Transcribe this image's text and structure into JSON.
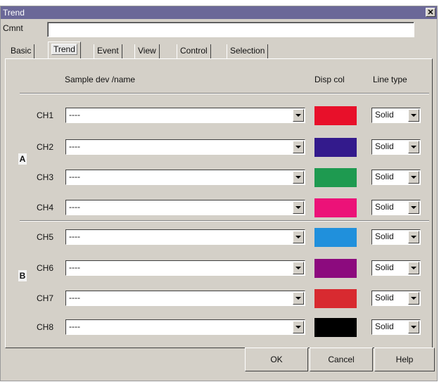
{
  "window": {
    "title": "Trend"
  },
  "comment": {
    "label": "Cmnt",
    "value": ""
  },
  "tabs": [
    "Basic",
    "Trend",
    "Event",
    "View",
    "Control",
    "Selection"
  ],
  "active_tab": "Trend",
  "headers": {
    "sample": "Sample dev /name",
    "color": "Disp col",
    "line_type": "Line type"
  },
  "groups": [
    "A",
    "B"
  ],
  "channels": [
    {
      "label": "CH1",
      "device": "----",
      "color": "#e8102a",
      "line_type": "Solid"
    },
    {
      "label": "CH2",
      "device": "----",
      "color": "#331a8c",
      "line_type": "Solid"
    },
    {
      "label": "CH3",
      "device": "----",
      "color": "#1e9a50",
      "line_type": "Solid"
    },
    {
      "label": "CH4",
      "device": "----",
      "color": "#ec1278",
      "line_type": "Solid"
    },
    {
      "label": "CH5",
      "device": "----",
      "color": "#2090dc",
      "line_type": "Solid"
    },
    {
      "label": "CH6",
      "device": "----",
      "color": "#8c0a7e",
      "line_type": "Solid"
    },
    {
      "label": "CH7",
      "device": "----",
      "color": "#d82a30",
      "line_type": "Solid"
    },
    {
      "label": "CH8",
      "device": "----",
      "color": "#000000",
      "line_type": "Solid"
    }
  ],
  "buttons": {
    "ok": "OK",
    "cancel": "Cancel",
    "help": "Help"
  }
}
